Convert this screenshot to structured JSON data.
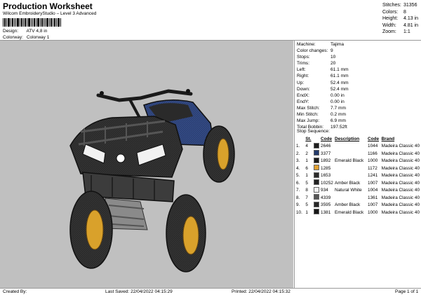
{
  "header": {
    "title": "Production Worksheet",
    "subtitle": "Wilcom EmbroideryStudio – Level 3 Advanced"
  },
  "meta": [
    {
      "label": "Design:",
      "value": "ATV 4,8 in"
    },
    {
      "label": "Colorway:",
      "value": "Colorway 1"
    }
  ],
  "stats": [
    {
      "label": "Stitches:",
      "value": "31356"
    },
    {
      "label": "Colors:",
      "value": "8"
    },
    {
      "label": "Height:",
      "value": "4.13 in"
    },
    {
      "label": "Width:",
      "value": "4.81 in"
    },
    {
      "label": "Zoom:",
      "value": "1:1"
    }
  ],
  "machine": [
    {
      "label": "Machine:",
      "value": "Tajima"
    },
    {
      "label": "Color changes:",
      "value": "9"
    },
    {
      "label": "Stops:",
      "value": "10"
    },
    {
      "label": "Trims:",
      "value": "20"
    },
    {
      "label": "Left:",
      "value": "61.1 mm"
    },
    {
      "label": "Right:",
      "value": "61.1 mm"
    },
    {
      "label": "Up:",
      "value": "52.4 mm"
    },
    {
      "label": "Down:",
      "value": "52.4 mm"
    },
    {
      "label": "EndX:",
      "value": "0.00 in"
    },
    {
      "label": "EndY:",
      "value": "0.00 in"
    },
    {
      "label": "Max Stitch:",
      "value": "7.7 mm"
    },
    {
      "label": "Min Stitch:",
      "value": "0.2 mm"
    },
    {
      "label": "Max Jump:",
      "value": "6.9 mm"
    },
    {
      "label": "Total Bobbin:",
      "value": "197.52ft"
    }
  ],
  "stop_sequence": {
    "title": "Stop Sequence:",
    "headers": {
      "st": "St.",
      "code": "Code",
      "description": "Description",
      "code2": "Code",
      "brand": "Brand"
    },
    "rows": [
      {
        "n": "1.",
        "st": "4",
        "color": "#1c1c1c",
        "code": "2646",
        "description": "",
        "code2": "1044",
        "brand": "Madeira Classic 40"
      },
      {
        "n": "2.",
        "st": "2",
        "color": "#233a6b",
        "code": "3377",
        "description": "",
        "code2": "1166",
        "brand": "Madeira Classic 40"
      },
      {
        "n": "3.",
        "st": "1",
        "color": "#1a1a1a",
        "code": "1892",
        "description": "Emerald Black",
        "code2": "1000",
        "brand": "Madeira Classic 40"
      },
      {
        "n": "4.",
        "st": "6",
        "color": "#e0a030",
        "code": "1285",
        "description": "",
        "code2": "1172",
        "brand": "Madeira Classic 40"
      },
      {
        "n": "5.",
        "st": "1",
        "color": "#2a2a2a",
        "code": "1653",
        "description": "",
        "code2": "1241",
        "brand": "Madeira Classic 40"
      },
      {
        "n": "6.",
        "st": "5",
        "color": "#222222",
        "code": "10252",
        "description": "Amber Black",
        "code2": "1007",
        "brand": "Madeira Classic 40"
      },
      {
        "n": "7.",
        "st": "8",
        "color": "#f2f2f2",
        "code": "934",
        "description": "Natural White",
        "code2": "1004",
        "brand": "Madeira Classic 40"
      },
      {
        "n": "8.",
        "st": "7",
        "color": "#555555",
        "code": "4339",
        "description": "",
        "code2": "1361",
        "brand": "Madeira Classic 40"
      },
      {
        "n": "9.",
        "st": "5",
        "color": "#262626",
        "code": "3595",
        "description": "Amber Black",
        "code2": "1007",
        "brand": "Madeira Classic 40"
      },
      {
        "n": "10.",
        "st": "1",
        "color": "#161616",
        "code": "1381",
        "description": "Emerald Black",
        "code2": "1000",
        "brand": "Madeira Classic 40"
      }
    ]
  },
  "footer": {
    "created_by": "Created By:",
    "last_saved": "Last Saved: 22/04/2022 04:15:29",
    "printed": "Printed: 22/04/2022 04:15:32",
    "page": "Page 1 of 1"
  },
  "colors": {
    "canvas_bg": "#c0c0c0",
    "body_blue": "#2b3f73",
    "rim_yellow": "#d9a12b"
  }
}
